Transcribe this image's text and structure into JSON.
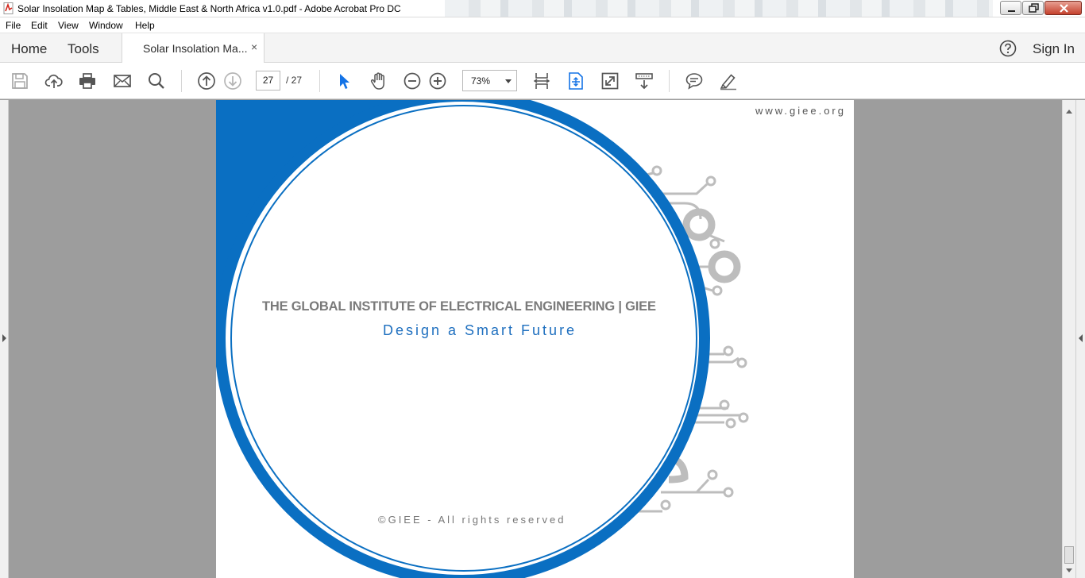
{
  "window": {
    "title": "Solar Insolation Map & Tables, Middle East & North Africa v1.0.pdf - Adobe Acrobat Pro DC"
  },
  "menu": [
    "File",
    "Edit",
    "View",
    "Window",
    "Help"
  ],
  "tabs": {
    "home": "Home",
    "tools": "Tools",
    "document": "Solar Insolation Ma...",
    "close_glyph": "×",
    "sign_in": "Sign In"
  },
  "toolbar": {
    "page_current": "27",
    "page_total": "/  27",
    "zoom": "73%",
    "icons": [
      "save-icon",
      "upload-cloud-icon",
      "print-icon",
      "email-icon",
      "search-icon",
      "previous-page-icon",
      "next-page-icon",
      "select-arrow-icon",
      "hand-tool-icon",
      "zoom-out-icon",
      "zoom-in-icon",
      "fit-page-icon",
      "scroll-mode-icon",
      "full-screen-icon",
      "read-mode-icon",
      "comment-icon",
      "highlight-pen-icon"
    ]
  },
  "page": {
    "url": "www.giee.org",
    "heading": "THE GLOBAL INSTITUTE OF ELECTRICAL ENGINEERING | GIEE",
    "tagline": "Design a Smart Future",
    "copyright": "©GIEE - All rights reserved"
  },
  "colors": {
    "brand_blue": "#0a6fc2",
    "circuit_grey": "#bdbdbd",
    "heading_grey": "#7a7a7a",
    "viewer_background": "#9d9d9d"
  }
}
